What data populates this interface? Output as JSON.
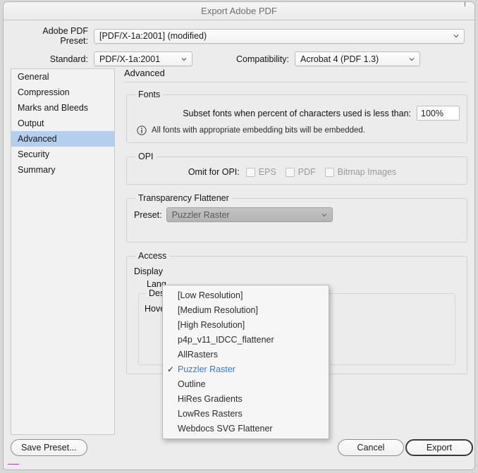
{
  "window": {
    "title": "Export Adobe PDF"
  },
  "header": {
    "preset_label": "Adobe PDF Preset:",
    "preset_value": "[PDF/X-1a:2001] (modified)",
    "standard_label": "Standard:",
    "standard_value": "PDF/X-1a:2001",
    "compatibility_label": "Compatibility:",
    "compatibility_value": "Acrobat 4 (PDF 1.3)"
  },
  "sidebar": {
    "items": [
      {
        "label": "General",
        "selected": false
      },
      {
        "label": "Compression",
        "selected": false
      },
      {
        "label": "Marks and Bleeds",
        "selected": false
      },
      {
        "label": "Output",
        "selected": false
      },
      {
        "label": "Advanced",
        "selected": true
      },
      {
        "label": "Security",
        "selected": false
      },
      {
        "label": "Summary",
        "selected": false
      }
    ]
  },
  "panel": {
    "title": "Advanced",
    "fonts": {
      "legend": "Fonts",
      "subset_label": "Subset fonts when percent of characters used is less than:",
      "subset_value": "100%",
      "note_icon": "info-icon",
      "note": "All fonts with appropriate embedding bits will be embedded."
    },
    "opi": {
      "legend": "OPI",
      "omit_label": "Omit for OPI:",
      "checkboxes": [
        {
          "label": "EPS",
          "checked": false
        },
        {
          "label": "PDF",
          "checked": false
        },
        {
          "label": "Bitmap Images",
          "checked": false
        }
      ]
    },
    "transparency": {
      "legend": "Transparency Flattener",
      "preset_label": "Preset:",
      "preset_value": "Puzzler Raster"
    },
    "accessibility": {
      "legend": "Access",
      "display_label": "Display",
      "language_label": "Lang",
      "description_legend": "Descr",
      "hover_label": "Hover"
    }
  },
  "dropdown": {
    "items": [
      {
        "label": "[Low Resolution]",
        "checked": false
      },
      {
        "label": "[Medium Resolution]",
        "checked": false
      },
      {
        "label": "[High Resolution]",
        "checked": false
      },
      {
        "label": "p4p_v11_IDCC_flattener",
        "checked": false
      },
      {
        "label": "AllRasters",
        "checked": false
      },
      {
        "label": "Puzzler Raster",
        "checked": true
      },
      {
        "label": "Outline",
        "checked": false
      },
      {
        "label": "HiRes Gradients",
        "checked": false
      },
      {
        "label": "LowRes Rasters",
        "checked": false
      },
      {
        "label": "Webdocs SVG Flattener",
        "checked": false
      }
    ],
    "check_glyph": "✓",
    "highlight_color": "#2f7bea"
  },
  "footer": {
    "save_preset_label": "Save Preset...",
    "cancel_label": "Cancel",
    "export_label": "Export"
  }
}
